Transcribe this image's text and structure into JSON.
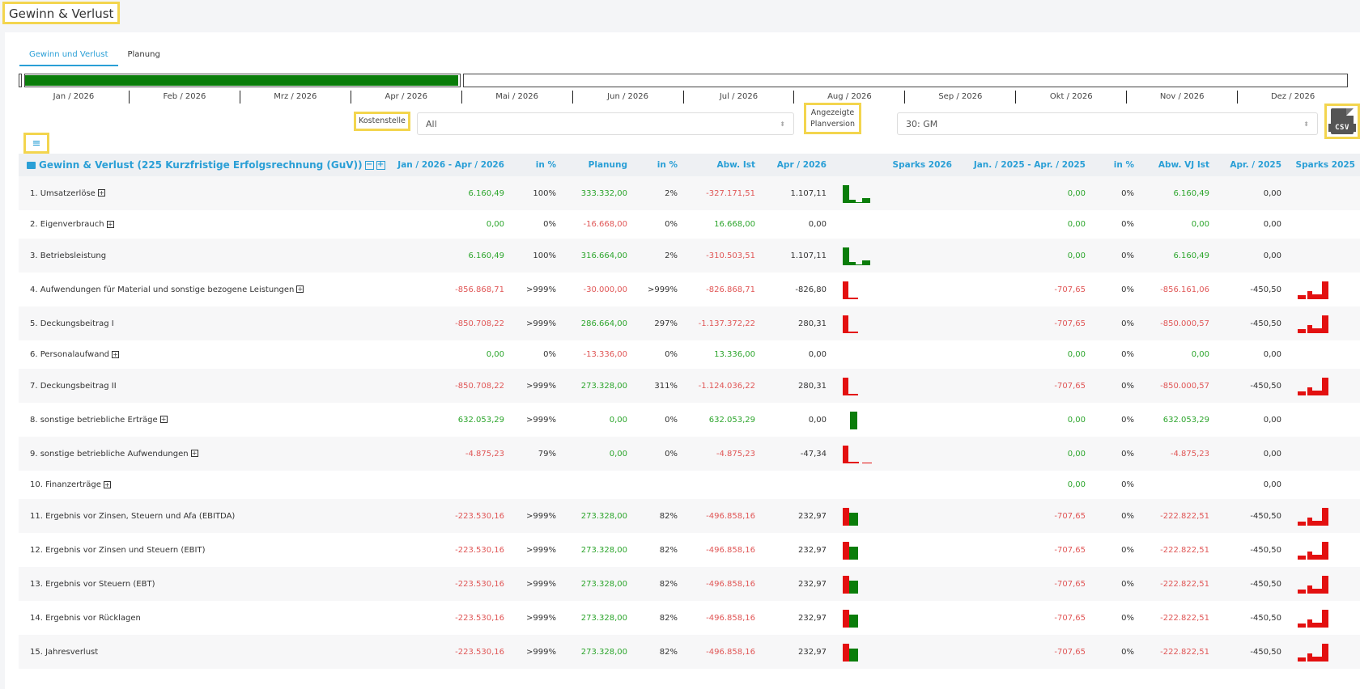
{
  "page": {
    "title": "Gewinn & Verlust"
  },
  "tabs": [
    {
      "label": "Gewinn und Verlust",
      "active": true
    },
    {
      "label": "Planung",
      "active": false
    }
  ],
  "timeline": {
    "months": [
      "Jan / 2026",
      "Feb / 2026",
      "Mrz / 2026",
      "Apr / 2026",
      "Mai / 2026",
      "Jun / 2026",
      "Jul / 2026",
      "Aug / 2026",
      "Sep / 2026",
      "Okt / 2026",
      "Nov / 2026",
      "Dez / 2026"
    ],
    "selected_range": [
      "Jan / 2026",
      "Apr / 2026"
    ],
    "fill_color": "#0a7d0a"
  },
  "filters": {
    "kostenstelle_label": "Kostenstelle",
    "kostenstelle_value": "All",
    "planversion_label_line1": "Angezeigte",
    "planversion_label_line2": "Planversion",
    "planversion_value": "30: GM"
  },
  "csv_button": {
    "label": "CSV"
  },
  "table": {
    "title": "Gewinn & Verlust (225 Kurzfristige Erfolgsrechnung (GuV))",
    "columns": [
      "Jan / 2026 - Apr / 2026",
      "in %",
      "Planung",
      "in %",
      "Abw. Ist",
      "Apr / 2026",
      "Sparks 2026",
      "Jan. / 2025 - Apr. / 2025",
      "in %",
      "Abw. VJ Ist",
      "Apr. / 2025",
      "Sparks 2025"
    ],
    "rows": [
      {
        "label": "1. Umsatzerlöse",
        "expandable": true,
        "v": [
          "6.160,49",
          "100%",
          "333.332,00",
          "2%",
          "-327.171,51",
          "1.107,11",
          "0,00",
          "0%",
          "6.160,49",
          "0,00"
        ],
        "c": [
          "pos",
          "neu",
          "pos",
          "neu",
          "neg",
          "neu",
          "pos",
          "neu",
          "pos",
          "neu"
        ],
        "spark26": "umsatz",
        "spark25": "none"
      },
      {
        "label": "2. Eigenverbrauch",
        "expandable": true,
        "v": [
          "0,00",
          "0%",
          "-16.668,00",
          "0%",
          "16.668,00",
          "0,00",
          "0,00",
          "0%",
          "0,00",
          "0,00"
        ],
        "c": [
          "pos",
          "neu",
          "neg",
          "neu",
          "pos",
          "neu",
          "pos",
          "neu",
          "pos",
          "neu"
        ],
        "spark26": "none",
        "spark25": "none"
      },
      {
        "label": "3. Betriebsleistung",
        "expandable": false,
        "v": [
          "6.160,49",
          "100%",
          "316.664,00",
          "2%",
          "-310.503,51",
          "1.107,11",
          "0,00",
          "0%",
          "6.160,49",
          "0,00"
        ],
        "c": [
          "pos",
          "neu",
          "pos",
          "neu",
          "neg",
          "neu",
          "pos",
          "neu",
          "pos",
          "neu"
        ],
        "spark26": "umsatz",
        "spark25": "none"
      },
      {
        "label": "4. Aufwendungen für Material und sonstige bezogene Leistungen",
        "expandable": true,
        "v": [
          "-856.868,71",
          ">999%",
          "-30.000,00",
          ">999%",
          "-826.868,71",
          "-826,80",
          "-707,65",
          "0%",
          "-856.161,06",
          "-450,50"
        ],
        "c": [
          "neg",
          "neu",
          "neg",
          "neu",
          "neg",
          "neu",
          "neg",
          "neu",
          "neg",
          "neu"
        ],
        "spark26": "red",
        "spark25": "red25"
      },
      {
        "label": "5. Deckungsbeitrag I",
        "expandable": false,
        "v": [
          "-850.708,22",
          ">999%",
          "286.664,00",
          "297%",
          "-1.137.372,22",
          "280,31",
          "-707,65",
          "0%",
          "-850.000,57",
          "-450,50"
        ],
        "c": [
          "neg",
          "neu",
          "pos",
          "neu",
          "neg",
          "neu",
          "neg",
          "neu",
          "neg",
          "neu"
        ],
        "spark26": "red",
        "spark25": "red25"
      },
      {
        "label": "6. Personalaufwand",
        "expandable": true,
        "v": [
          "0,00",
          "0%",
          "-13.336,00",
          "0%",
          "13.336,00",
          "0,00",
          "0,00",
          "0%",
          "0,00",
          "0,00"
        ],
        "c": [
          "pos",
          "neu",
          "neg",
          "neu",
          "pos",
          "neu",
          "pos",
          "neu",
          "pos",
          "neu"
        ],
        "spark26": "none",
        "spark25": "none"
      },
      {
        "label": "7. Deckungsbeitrag II",
        "expandable": false,
        "v": [
          "-850.708,22",
          ">999%",
          "273.328,00",
          "311%",
          "-1.124.036,22",
          "280,31",
          "-707,65",
          "0%",
          "-850.000,57",
          "-450,50"
        ],
        "c": [
          "neg",
          "neu",
          "pos",
          "neu",
          "neg",
          "neu",
          "neg",
          "neu",
          "neg",
          "neu"
        ],
        "spark26": "red",
        "spark25": "red25"
      },
      {
        "label": "8. sonstige betriebliche Erträge",
        "expandable": true,
        "v": [
          "632.053,29",
          ">999%",
          "0,00",
          "0%",
          "632.053,29",
          "0,00",
          "0,00",
          "0%",
          "632.053,29",
          "0,00"
        ],
        "c": [
          "pos",
          "neu",
          "pos",
          "neu",
          "pos",
          "neu",
          "pos",
          "neu",
          "pos",
          "neu"
        ],
        "spark26": "green",
        "spark25": "none"
      },
      {
        "label": "9. sonstige betriebliche Aufwendungen",
        "expandable": true,
        "v": [
          "-4.875,23",
          "79%",
          "0,00",
          "0%",
          "-4.875,23",
          "-47,34",
          "0,00",
          "0%",
          "-4.875,23",
          "0,00"
        ],
        "c": [
          "neg",
          "neu",
          "pos",
          "neu",
          "neg",
          "neu",
          "pos",
          "neu",
          "neg",
          "neu"
        ],
        "spark26": "redsmall",
        "spark25": "none"
      },
      {
        "label": "10. Finanzerträge",
        "expandable": true,
        "v": [
          "",
          "",
          "",
          "",
          "",
          "",
          "0,00",
          "0%",
          "",
          "0,00"
        ],
        "c": [
          "neu",
          "neu",
          "neu",
          "neu",
          "neu",
          "neu",
          "pos",
          "neu",
          "neu",
          "neu"
        ],
        "spark26": "none",
        "spark25": "none"
      },
      {
        "label": "11. Ergebnis vor Zinsen, Steuern und Afa (EBITDA)",
        "expandable": false,
        "v": [
          "-223.530,16",
          ">999%",
          "273.328,00",
          "82%",
          "-496.858,16",
          "232,97",
          "-707,65",
          "0%",
          "-222.822,51",
          "-450,50"
        ],
        "c": [
          "neg",
          "neu",
          "pos",
          "neu",
          "neg",
          "neu",
          "neg",
          "neu",
          "neg",
          "neu"
        ],
        "spark26": "mixed",
        "spark25": "red25"
      },
      {
        "label": "12. Ergebnis vor Zinsen und Steuern (EBIT)",
        "expandable": false,
        "v": [
          "-223.530,16",
          ">999%",
          "273.328,00",
          "82%",
          "-496.858,16",
          "232,97",
          "-707,65",
          "0%",
          "-222.822,51",
          "-450,50"
        ],
        "c": [
          "neg",
          "neu",
          "pos",
          "neu",
          "neg",
          "neu",
          "neg",
          "neu",
          "neg",
          "neu"
        ],
        "spark26": "mixed",
        "spark25": "red25"
      },
      {
        "label": "13. Ergebnis vor Steuern (EBT)",
        "expandable": false,
        "v": [
          "-223.530,16",
          ">999%",
          "273.328,00",
          "82%",
          "-496.858,16",
          "232,97",
          "-707,65",
          "0%",
          "-222.822,51",
          "-450,50"
        ],
        "c": [
          "neg",
          "neu",
          "pos",
          "neu",
          "neg",
          "neu",
          "neg",
          "neu",
          "neg",
          "neu"
        ],
        "spark26": "mixed",
        "spark25": "red25"
      },
      {
        "label": "14. Ergebnis vor Rücklagen",
        "expandable": false,
        "v": [
          "-223.530,16",
          ">999%",
          "273.328,00",
          "82%",
          "-496.858,16",
          "232,97",
          "-707,65",
          "0%",
          "-222.822,51",
          "-450,50"
        ],
        "c": [
          "neg",
          "neu",
          "pos",
          "neu",
          "neg",
          "neu",
          "neg",
          "neu",
          "neg",
          "neu"
        ],
        "spark26": "mixed",
        "spark25": "red25"
      },
      {
        "label": "15. Jahresverlust",
        "expandable": false,
        "v": [
          "-223.530,16",
          ">999%",
          "273.328,00",
          "82%",
          "-496.858,16",
          "232,97",
          "-707,65",
          "0%",
          "-222.822,51",
          "-450,50"
        ],
        "c": [
          "neg",
          "neu",
          "pos",
          "neu",
          "neg",
          "neu",
          "neg",
          "neu",
          "neg",
          "neu"
        ],
        "spark26": "mixed",
        "spark25": "red25"
      }
    ]
  },
  "colors": {
    "accent": "#2a9fd6",
    "positive": "#2ca52c",
    "negative": "#e05656",
    "highlight": "#f3d54e",
    "spark_green": "#0a7d0a",
    "spark_red": "#e31010"
  }
}
